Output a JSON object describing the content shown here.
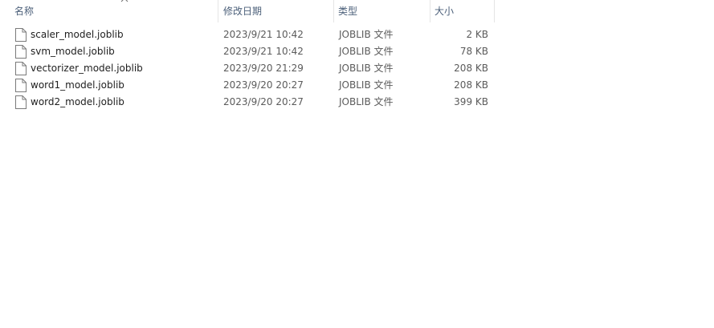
{
  "columns": {
    "name": "名称",
    "date_modified": "修改日期",
    "type": "类型",
    "size": "大小"
  },
  "sort": {
    "column": "name",
    "direction": "ascending",
    "icon": "chevron-up-icon"
  },
  "files": [
    {
      "name": "scaler_model.joblib",
      "date": "2023/9/21 10:42",
      "type": "JOBLIB 文件",
      "size": "2 KB",
      "icon": "file-icon"
    },
    {
      "name": "svm_model.joblib",
      "date": "2023/9/21 10:42",
      "type": "JOBLIB 文件",
      "size": "78 KB",
      "icon": "file-icon"
    },
    {
      "name": "vectorizer_model.joblib",
      "date": "2023/9/20 21:29",
      "type": "JOBLIB 文件",
      "size": "208 KB",
      "icon": "file-icon"
    },
    {
      "name": "word1_model.joblib",
      "date": "2023/9/20 20:27",
      "type": "JOBLIB 文件",
      "size": "208 KB",
      "icon": "file-icon"
    },
    {
      "name": "word2_model.joblib",
      "date": "2023/9/20 20:27",
      "type": "JOBLIB 文件",
      "size": "399 KB",
      "icon": "file-icon"
    }
  ],
  "colors": {
    "header_text": "#4c607a",
    "row_text": "#1e1e1e",
    "secondary_text": "#5b5b5b",
    "separator": "#e5e5e5"
  }
}
